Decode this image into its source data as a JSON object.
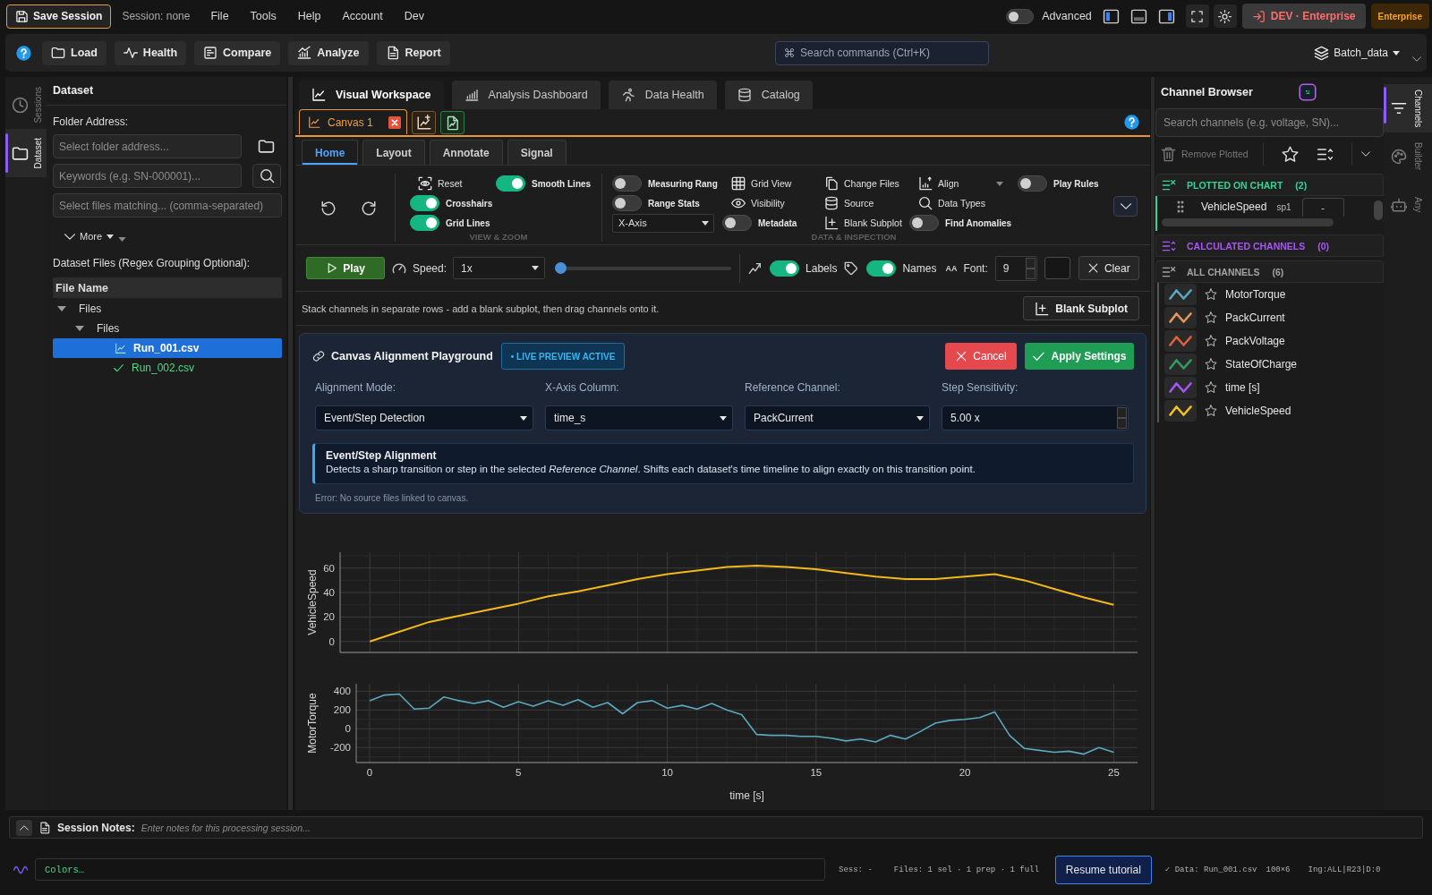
{
  "top_bar": {
    "save_button": "Save Session",
    "session_label": "Session: none",
    "menu": [
      "File",
      "Tools",
      "Help",
      "Account",
      "Dev"
    ],
    "advanced_toggle": {
      "label": "Advanced",
      "on": false
    },
    "panel_toggles": [
      {
        "on": true
      },
      {
        "on": false
      },
      {
        "on": true
      }
    ],
    "environment_button": "DEV · Enterprise",
    "plan_badge": "Enterprise"
  },
  "toolbar": {
    "buttons": [
      "Load",
      "Health",
      "Compare",
      "Analyze",
      "Report"
    ],
    "search": {
      "placeholder": "Search commands (Ctrl+K)"
    },
    "batch_menu": "Batch_data"
  },
  "left_rail": [
    {
      "label": "Sessions",
      "selected": false
    },
    {
      "label": "Dataset",
      "selected": true
    }
  ],
  "dataset_panel": {
    "title": "Dataset",
    "folder_label": "Folder Address:",
    "folder_field": {
      "placeholder": "Select folder address..."
    },
    "keywords_field": {
      "placeholder": "Keywords (e.g. SN-000001)..."
    },
    "match_field": {
      "placeholder": "Select files matching... (comma-separated)"
    },
    "more_button": "More",
    "files_label": "Dataset Files (Regex Grouping Optional):",
    "files_table": {
      "column": "File Name",
      "tree": [
        {
          "label": "Files",
          "expanded": true,
          "selected": false,
          "children": [
            {
              "label": "Files",
              "expanded": true,
              "selected": false,
              "children": [
                {
                  "label": "Run_001.csv",
                  "kind": "chart",
                  "selected": true
                },
                {
                  "label": "Run_002.csv",
                  "kind": "check",
                  "selected": false
                }
              ]
            }
          ]
        }
      ]
    }
  },
  "workspace": {
    "tabs": [
      {
        "label": "Visual Workspace",
        "selected": true
      },
      {
        "label": "Analysis Dashboard",
        "selected": false
      },
      {
        "label": "Data Health",
        "selected": false
      },
      {
        "label": "Catalog",
        "selected": false
      }
    ],
    "canvas_tabs": [
      {
        "label": "Canvas 1",
        "selected": true
      }
    ],
    "ribbon": {
      "tabs": [
        {
          "label": "Home",
          "selected": true
        },
        {
          "label": "Layout",
          "selected": false
        },
        {
          "label": "Annotate",
          "selected": false
        },
        {
          "label": "Signal",
          "selected": false
        }
      ],
      "view_zoom": {
        "title": "VIEW & ZOOM",
        "reset": "Reset",
        "smooth_lines": {
          "label": "Smooth Lines",
          "on": true
        },
        "crosshairs": {
          "label": "Crosshairs",
          "on": true
        },
        "grid_lines": {
          "label": "Grid Lines",
          "on": true
        }
      },
      "data_inspection": {
        "title": "DATA & INSPECTION",
        "measuring_range": {
          "label": "Measuring Rang",
          "on": false
        },
        "grid_view": "Grid View",
        "change_files": "Change Files",
        "align": "Align",
        "play_rules": {
          "label": "Play Rules",
          "on": false
        },
        "range_stats": {
          "label": "Range Stats",
          "on": false
        },
        "visibility": "Visibility",
        "source": "Source",
        "data_types": "Data Types",
        "x_axis": "X-Axis",
        "metadata": {
          "label": "Metadata",
          "on": false
        },
        "blank_subplot": "Blank Subplot",
        "find_anomalies": {
          "label": "Find Anomalies",
          "on": false
        }
      }
    },
    "playback": {
      "play_button": "Play",
      "speed_label": "Speed:",
      "speed": "1x",
      "scrubber": {
        "level": 0
      },
      "labels_toggle": {
        "label": "Labels",
        "on": true
      },
      "names_toggle": {
        "label": "Names",
        "on": true
      },
      "font_glyph": "AA",
      "font_label": "Font:",
      "font_size": "9",
      "clear_button": "Clear"
    },
    "hint": {
      "text": "Stack channels in separate rows - add a blank subplot, then drag channels onto it.",
      "button": "Blank Subplot"
    },
    "alignment": {
      "title": "Canvas Alignment Playground",
      "badge": "• LIVE PREVIEW ACTIVE",
      "cancel": "Cancel",
      "apply": "Apply Settings",
      "fields": [
        {
          "label": "Alignment Mode:",
          "value": "Event/Step Detection",
          "kind": "select"
        },
        {
          "label": "X-Axis Column:",
          "value": "time_s",
          "kind": "select"
        },
        {
          "label": "Reference Channel:",
          "value": "PackCurrent",
          "kind": "select"
        },
        {
          "label": "Step Sensitivity:",
          "value": "5.00 x",
          "kind": "number"
        }
      ],
      "info": {
        "title": "Event/Step Alignment",
        "text": "Detects a sharp transition or step in the selected *Reference Channel*. Shifts each dataset's time timeline to align exactly on this transition point."
      },
      "error": "Error: No source files linked to canvas."
    },
    "plots": [
      {
        "chart_data": {
          "type": "line",
          "ylabel": "VehicleSpeed",
          "categories": [
            null,
            null,
            null,
            null,
            null,
            null,
            null,
            null,
            null,
            null,
            null,
            null,
            null,
            null,
            null,
            null,
            null,
            null,
            null,
            null,
            null,
            null,
            null,
            null,
            null,
            null
          ],
          "series": [
            {
              "color": "#f2b81c",
              "values": [
                0,
                8,
                16,
                21,
                26,
                31,
                37,
                41,
                46,
                51,
                55,
                58,
                61,
                62,
                61,
                59,
                56,
                53,
                51,
                51,
                53,
                55,
                50,
                43,
                36,
                30
              ]
            }
          ],
          "ylim": [
            -9,
            73
          ],
          "yticks": [
            0,
            20,
            40,
            60
          ],
          "grid": true
        }
      },
      {
        "chart_data": {
          "type": "line",
          "xlabel": "time [s]",
          "ylabel": "MotorTorque",
          "x": [
            0,
            0.5,
            1,
            1.5,
            2,
            2.5,
            3,
            3.5,
            4,
            4.5,
            5,
            5.5,
            6,
            6.5,
            7,
            7.5,
            8,
            8.5,
            9,
            9.5,
            10,
            10.5,
            11,
            11.5,
            12,
            12.5,
            13,
            13.5,
            14,
            14.5,
            15,
            15.5,
            16,
            16.5,
            17,
            17.5,
            18,
            18.5,
            19,
            19.5,
            20,
            20.5,
            21,
            21.5,
            22,
            22.5,
            23,
            23.5,
            24,
            24.5,
            25
          ],
          "series": [
            {
              "color": "#5aa9bf",
              "values": [
                300,
                360,
                370,
                210,
                220,
                340,
                300,
                270,
                300,
                230,
                290,
                240,
                300,
                250,
                310,
                230,
                280,
                160,
                280,
                300,
                220,
                250,
                210,
                270,
                200,
                150,
                -60,
                -70,
                -70,
                -80,
                -80,
                -100,
                -130,
                -110,
                -140,
                -70,
                -110,
                -30,
                60,
                90,
                100,
                120,
                180,
                -70,
                -210,
                -230,
                -250,
                -240,
                -270,
                -200,
                -250
              ]
            }
          ],
          "xlim": [
            -0.45,
            25.8
          ],
          "ylim": [
            -360,
            480
          ],
          "xticks": [
            0,
            5,
            10,
            15,
            20,
            25
          ],
          "yticks": [
            -200,
            0,
            200,
            400
          ],
          "grid": true
        }
      }
    ]
  },
  "channel_browser": {
    "title": "Channel Browser",
    "search": {
      "placeholder": "Search channels (e.g. voltage, SN)..."
    },
    "remove_button": {
      "label": "Remove Plotted",
      "disabled": true
    },
    "sections": [
      {
        "kind": "plotted",
        "title": "PLOTTED ON CHART",
        "count": "(2)",
        "color": "#34d399",
        "rows": [
          {
            "name": "VehicleSpeed",
            "subplot": "sp1",
            "value": "-"
          }
        ]
      },
      {
        "kind": "calculated",
        "title": "CALCULATED CHANNELS",
        "count": "(0)",
        "color": "#a855f7"
      },
      {
        "kind": "all",
        "title": "ALL CHANNELS",
        "count": "(6)",
        "color": "#a3a3a3",
        "channels": [
          {
            "name": "MotorTorque",
            "color": "#5aa9bf"
          },
          {
            "name": "PackCurrent",
            "color": "#e8955a"
          },
          {
            "name": "PackVoltage",
            "color": "#e2603c"
          },
          {
            "name": "StateOfCharge",
            "color": "#2f9e63"
          },
          {
            "name": "time [s]",
            "color": "#a855f7"
          },
          {
            "name": "VehicleSpeed",
            "color": "#f2c21b"
          }
        ]
      }
    ]
  },
  "right_rail": [
    {
      "label": "Channels",
      "selected": true
    },
    {
      "label": "Builder",
      "selected": false
    },
    {
      "label": "Any",
      "selected": false
    }
  ],
  "session_notes": {
    "label": "Session Notes:",
    "placeholder": "Enter notes for this processing session..."
  },
  "status_bar": {
    "command_value": "Colors…",
    "session": "Sess: -",
    "files": "Files: 1 sel · 1 prep · 1 full",
    "tutorial_button": "Resume tutorial",
    "data": "✓ Data: Run_001.csv",
    "data_size": "100×6",
    "ingest": "Ing:ALL|R23|D:0"
  }
}
